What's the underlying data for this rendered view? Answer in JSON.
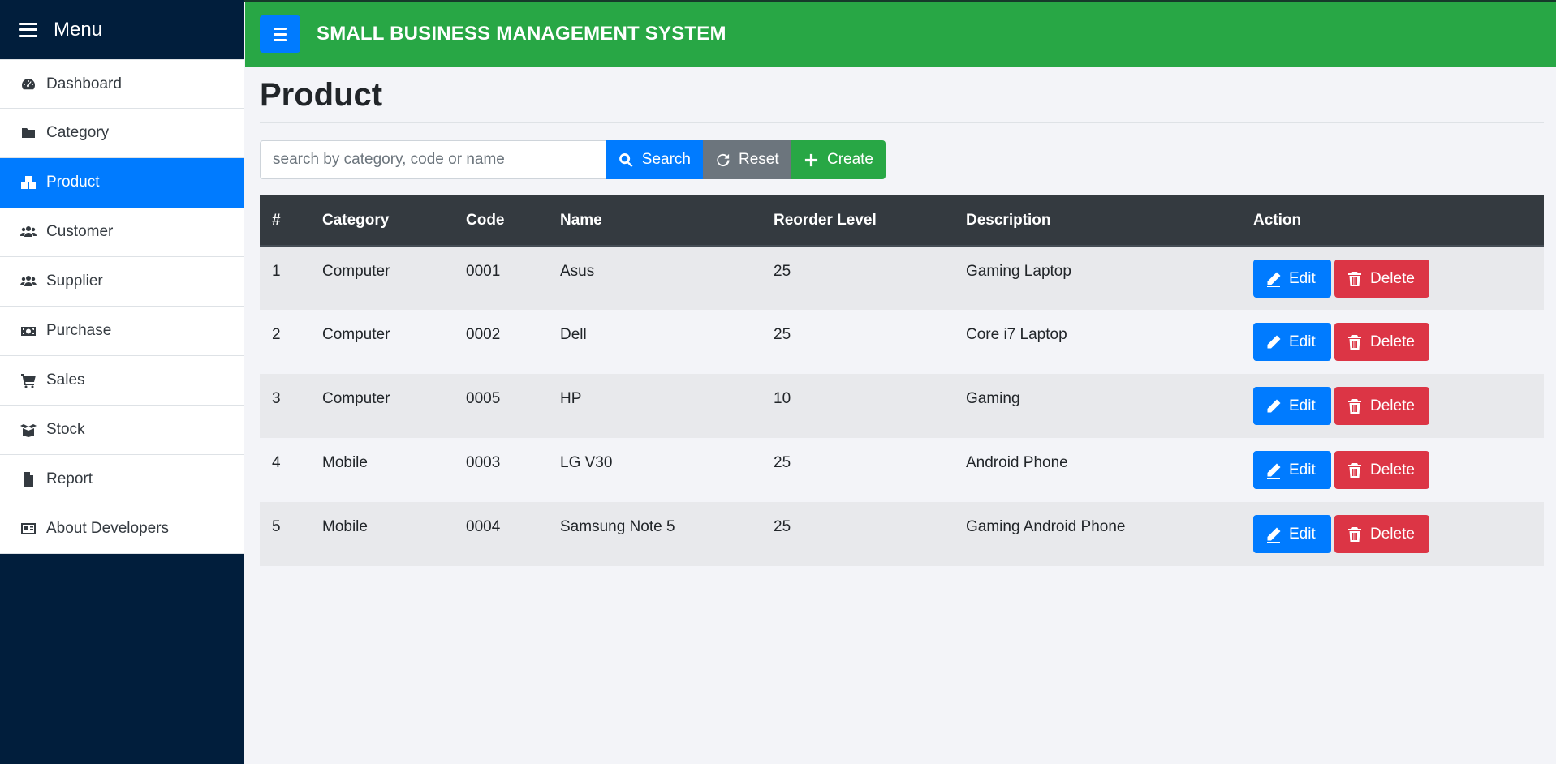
{
  "sidebar": {
    "title": "Menu",
    "items": [
      {
        "label": "Dashboard",
        "icon": "dashboard-icon"
      },
      {
        "label": "Category",
        "icon": "folder-icon"
      },
      {
        "label": "Product",
        "icon": "boxes-icon",
        "active": true
      },
      {
        "label": "Customer",
        "icon": "users-icon"
      },
      {
        "label": "Supplier",
        "icon": "users-icon"
      },
      {
        "label": "Purchase",
        "icon": "money-bill-icon"
      },
      {
        "label": "Sales",
        "icon": "cart-icon"
      },
      {
        "label": "Stock",
        "icon": "box-open-icon"
      },
      {
        "label": "Report",
        "icon": "file-icon"
      },
      {
        "label": "About Developers",
        "icon": "id-card-icon"
      }
    ]
  },
  "header": {
    "title": "SMALL BUSINESS MANAGEMENT SYSTEM"
  },
  "page": {
    "title": "Product"
  },
  "toolbar": {
    "search_placeholder": "search by category, code or name",
    "search_label": "Search",
    "reset_label": "Reset",
    "create_label": "Create"
  },
  "table": {
    "columns": [
      "#",
      "Category",
      "Code",
      "Name",
      "Reorder Level",
      "Description",
      "Action"
    ],
    "rows": [
      {
        "no": "1",
        "category": "Computer",
        "code": "0001",
        "name": "Asus",
        "reorder": "25",
        "description": "Gaming Laptop"
      },
      {
        "no": "2",
        "category": "Computer",
        "code": "0002",
        "name": "Dell",
        "reorder": "25",
        "description": "Core i7 Laptop"
      },
      {
        "no": "3",
        "category": "Computer",
        "code": "0005",
        "name": "HP",
        "reorder": "10",
        "description": "Gaming"
      },
      {
        "no": "4",
        "category": "Mobile",
        "code": "0003",
        "name": "LG V30",
        "reorder": "25",
        "description": "Android Phone"
      },
      {
        "no": "5",
        "category": "Mobile",
        "code": "0004",
        "name": "Samsung Note 5",
        "reorder": "25",
        "description": "Gaming Android Phone"
      }
    ],
    "edit_label": "Edit",
    "delete_label": "Delete"
  },
  "colors": {
    "sidebar_bg": "#011e3c",
    "header_bg": "#28a745",
    "primary": "#007bff",
    "danger": "#dc3545",
    "secondary": "#6c757d",
    "table_header_bg": "#343a40"
  }
}
